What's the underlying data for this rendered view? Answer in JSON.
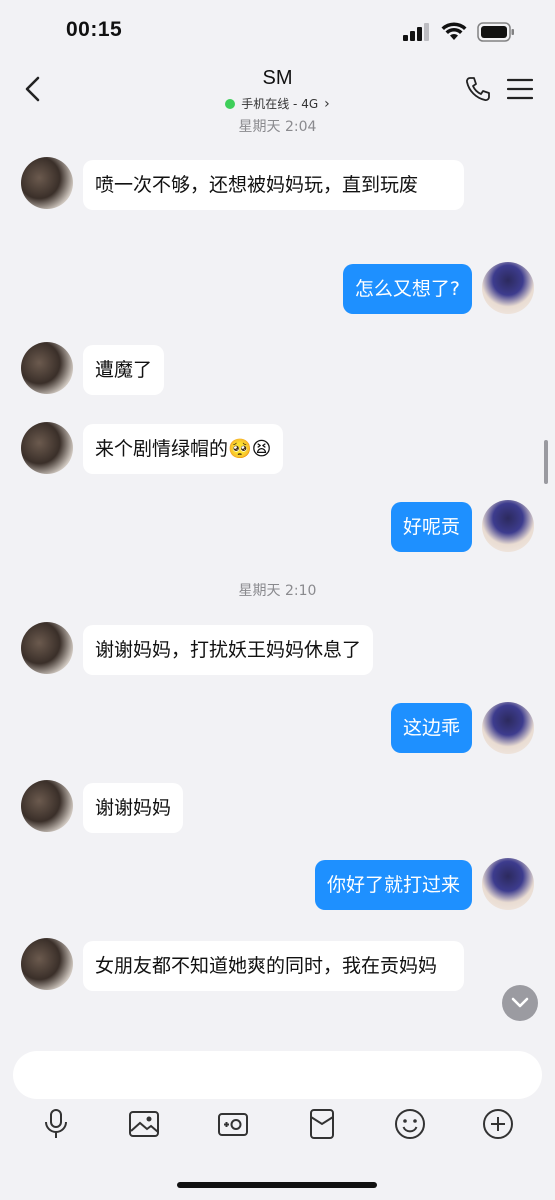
{
  "status_bar": {
    "time": "00:15"
  },
  "header": {
    "title": "SM",
    "subtitle": "手机在线 - 4G",
    "subtitle_chevron": "›"
  },
  "timestamps": [
    "星期天 2:04",
    "星期天 2:10"
  ],
  "messages": [
    {
      "side": "in",
      "text": "喷一次不够，还想被妈妈玩，直到玩废"
    },
    {
      "side": "out",
      "text": "怎么又想了?"
    },
    {
      "side": "in",
      "text": "遭魔了"
    },
    {
      "side": "in",
      "text": "来个剧情绿帽的",
      "emoji": "🥺😫"
    },
    {
      "side": "out",
      "text": "好呢贡"
    },
    {
      "side": "in",
      "text": "谢谢妈妈，打扰妖王妈妈休息了"
    },
    {
      "side": "out",
      "text": "这边乖"
    },
    {
      "side": "in",
      "text": "谢谢妈妈"
    },
    {
      "side": "out",
      "text": "你好了就打过来"
    },
    {
      "side": "in",
      "text": "女朋友都不知道她爽的同时，我在贡妈妈"
    }
  ],
  "input": {
    "placeholder": ""
  },
  "toolbar_icons": [
    "microphone-icon",
    "image-icon",
    "video-camera-icon",
    "red-packet-icon",
    "emoji-icon",
    "plus-icon"
  ],
  "colors": {
    "outgoing_bubble": "#1e90ff",
    "incoming_bubble": "#ffffff",
    "background": "#f2f2f5",
    "online_dot": "#3ecf5a"
  }
}
